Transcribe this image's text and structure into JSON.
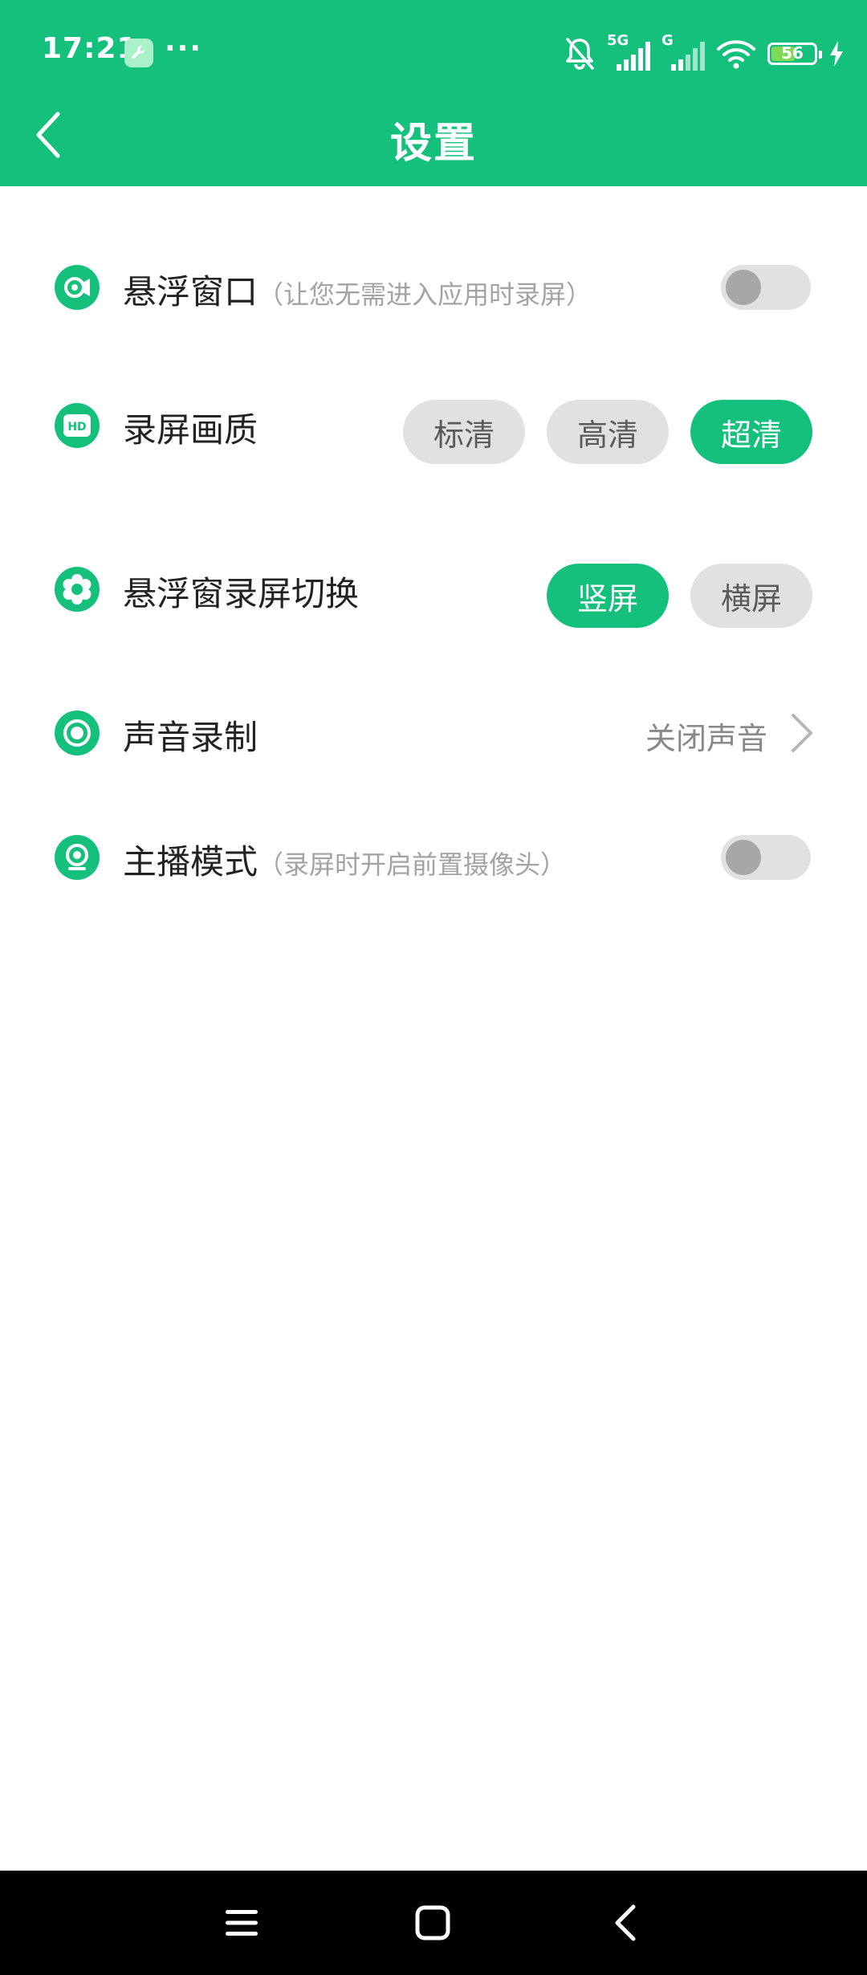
{
  "status_bar": {
    "time": "17:21",
    "battery": "56",
    "battery_level": 0.56,
    "sig1_label": "5G",
    "sig2_label": "G"
  },
  "header": {
    "title": "设置"
  },
  "settings": {
    "floating_window": {
      "label": "悬浮窗口",
      "sub": "（让您无需进入应用时录屏）",
      "enabled": false
    },
    "quality": {
      "label": "录屏画质",
      "options": [
        "标清",
        "高清",
        "超清"
      ],
      "selected": "超清"
    },
    "orientation": {
      "label": "悬浮窗录屏切换",
      "options": [
        "竖屏",
        "横屏"
      ],
      "selected": "竖屏"
    },
    "audio": {
      "label": "声音录制",
      "value": "关闭声音"
    },
    "streamer": {
      "label": "主播模式",
      "sub": "（录屏时开启前置摄像头）",
      "enabled": false
    }
  },
  "colors": {
    "accent": "#14c07b",
    "toggle_off": "#e1e1e1",
    "pill_inactive": "#e1e1e1",
    "subtext": "#a3a3a3"
  }
}
